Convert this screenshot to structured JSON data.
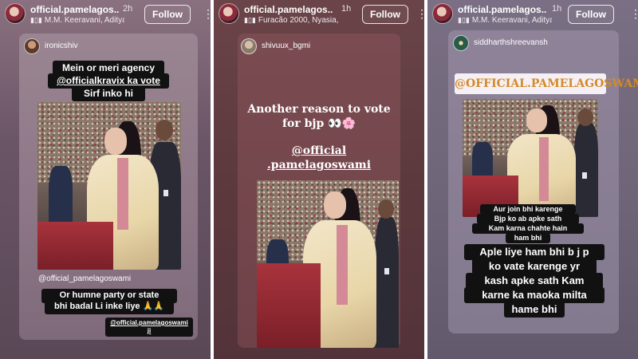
{
  "stories": [
    {
      "username": "official.pamelagos...",
      "age": "2h",
      "music": "M.M. Keeravani, Aditya...",
      "follow_label": "Follow",
      "reposter": "ironicshiv",
      "caption_lines": [
        "Mein or meri agency",
        "@officialkravix ka vote",
        "Sirf inko hi"
      ],
      "photo_tag": "@official_pamelagoswami",
      "caption2_lines": [
        "Or humne party or state",
        "bhi badal Li inke liye 🙏🙏"
      ],
      "mention_small": "@official.pamelagoswami ji"
    },
    {
      "username": "official.pamelagos...",
      "age": "1h",
      "music": "Furacão 2000, Nyasia,...",
      "follow_label": "Follow",
      "reposter": "shivuux_bgmi",
      "caption_lines": [
        "Another reason to vote",
        "for bjp 👀🌸"
      ],
      "mention_lines": [
        "@official",
        ".pamelagoswami"
      ]
    },
    {
      "username": "official.pamelagos...",
      "age": "1h",
      "music": "M.M. Keeravani, Aditya...",
      "follow_label": "Follow",
      "reposter": "siddharthshreevansh",
      "mention_box": "@OFFICIAL.PAMELAGOSWAMI",
      "caption_small_lines": [
        "Aur join bhi karenge",
        "Bjp ko ab apke sath",
        "Kam karna chahte hain",
        "ham bhi"
      ],
      "caption_big_lines": [
        "Aple liye ham bhi b j p",
        "ko vate karenge yr",
        "kash apke sath Kam",
        "karne ka maoka milta",
        "hame bhi"
      ]
    }
  ],
  "colors": {
    "follow_border": "#ffffff",
    "mention_box_text": "#d48a28",
    "podium": "#a8333c"
  },
  "icons": {
    "music": "music-bars-icon",
    "more": "more-vertical-icon"
  }
}
